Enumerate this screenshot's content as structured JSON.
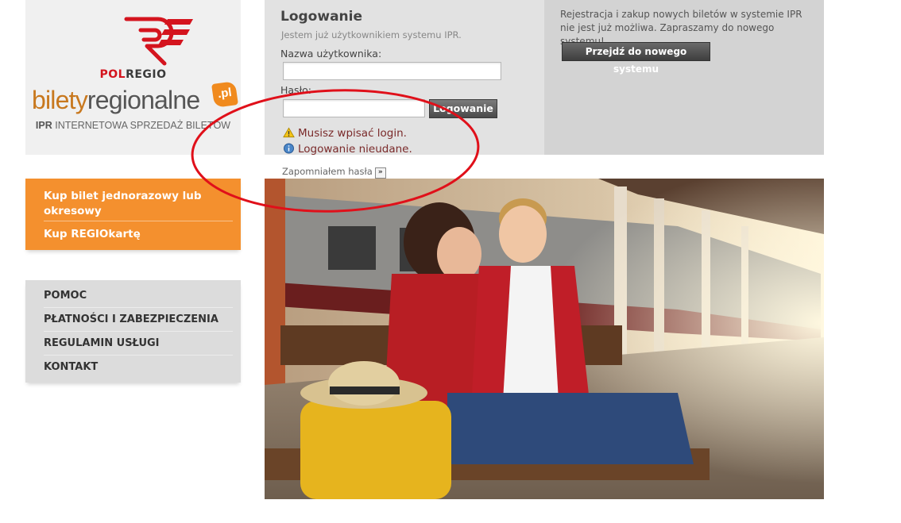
{
  "logo": {
    "brand_pol": "POL",
    "brand_regio": "REGIO",
    "site_name_1": "bilety",
    "site_name_2": "regionalne",
    "site_tld": ".pl",
    "tagline_ipr": "IPR",
    "tagline_rest": "INTERNETOWA SPRZEDAŻ BILETÓW",
    "brand_color": "#d4141e",
    "accent_color": "#f08a1e"
  },
  "orange_menu": {
    "items": [
      {
        "label": "Kup bilet jednorazowy lub okresowy"
      },
      {
        "label": "Kup REGIOkartę"
      }
    ],
    "color": "#f4902e"
  },
  "grey_menu": {
    "items": [
      {
        "label": "POMOC"
      },
      {
        "label": "PŁATNOŚCI I ZABEZPIECZENIA"
      },
      {
        "label": "REGULAMIN USŁUGI"
      },
      {
        "label": "KONTAKT"
      }
    ]
  },
  "login": {
    "title": "Logowanie",
    "subtitle": "Jestem już użytkownikiem systemu IPR.",
    "username_label": "Nazwa użytkownika:",
    "username_value": "",
    "password_label": "Hasło:",
    "password_value": "",
    "submit_label": "Logowanie",
    "warning_text": "Musisz wpisać login.",
    "info_text": "Logowanie nieudane.",
    "forgot_label": "Zapomniałem hasła",
    "forgot_arrow": "»"
  },
  "info": {
    "text": "Rejestracja i zakup nowych biletów w systemie IPR nie jest już możliwa. Zapraszamy do nowego systemu!",
    "button_label": "Przejdź do nowego systemu"
  },
  "annotation": {
    "color": "#e0101a"
  }
}
